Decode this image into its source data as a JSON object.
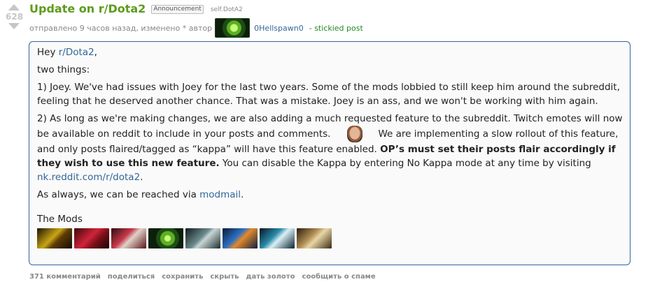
{
  "vote": {
    "score": "628"
  },
  "post": {
    "title": "Update on r/Dota2",
    "flair": "Announcement",
    "domain": "self.DotA2",
    "tagline_prefix": "отправлено 9 часов назад, изменено * автор",
    "author": "0Hellspawn0",
    "stickied": "- stickied post"
  },
  "body": {
    "greet_prefix": "Hey ",
    "greet_link": "r/Dota2",
    "greet_suffix": ",",
    "intro": "two things:",
    "p1": "1) Joey. We've had issues with Joey for the last two years. Some of the mods lobbied to still keep him around the subreddit, feeling that he deserved another chance. That was a mistake. Joey is an ass, and we won't be working with him again.",
    "p2_a": "2) As long as we're making changes, we are also adding a much requested feature to the subreddit. Twitch emotes will now be available on reddit to include in your posts and comments.",
    "p2_b": "We are implementing a slow rollout of this feature, and only posts flaired/tagged as “kappa” will have this feature enabled. ",
    "p2_bold": "OP’s must set their posts flair accordingly if they wish to use this new feature.",
    "p2_c": " You can disable the Kappa by entering No Kappa mode at any time by visiting ",
    "p2_link": "nk.reddit.com/r/dota2",
    "p2_end": ".",
    "p3_prefix": "As always, we can be reached via ",
    "p3_link": "modmail",
    "p3_end": ".",
    "signature": "The Mods"
  },
  "icons": [
    "kappa-emote-icon",
    "hero-icon-1",
    "hero-icon-2",
    "hero-icon-3",
    "hero-icon-4",
    "hero-icon-5",
    "hero-icon-6",
    "hero-icon-7",
    "hero-icon-8"
  ],
  "buttons": {
    "comments": "371 комментарий",
    "share": "поделиться",
    "save": "сохранить",
    "hide": "скрыть",
    "gild": "дать золото",
    "report": "сообщить о спаме"
  },
  "colors": {
    "title": "#5d9b1c",
    "link": "#336699",
    "stickied": "#228822",
    "box_border": "#336699"
  }
}
